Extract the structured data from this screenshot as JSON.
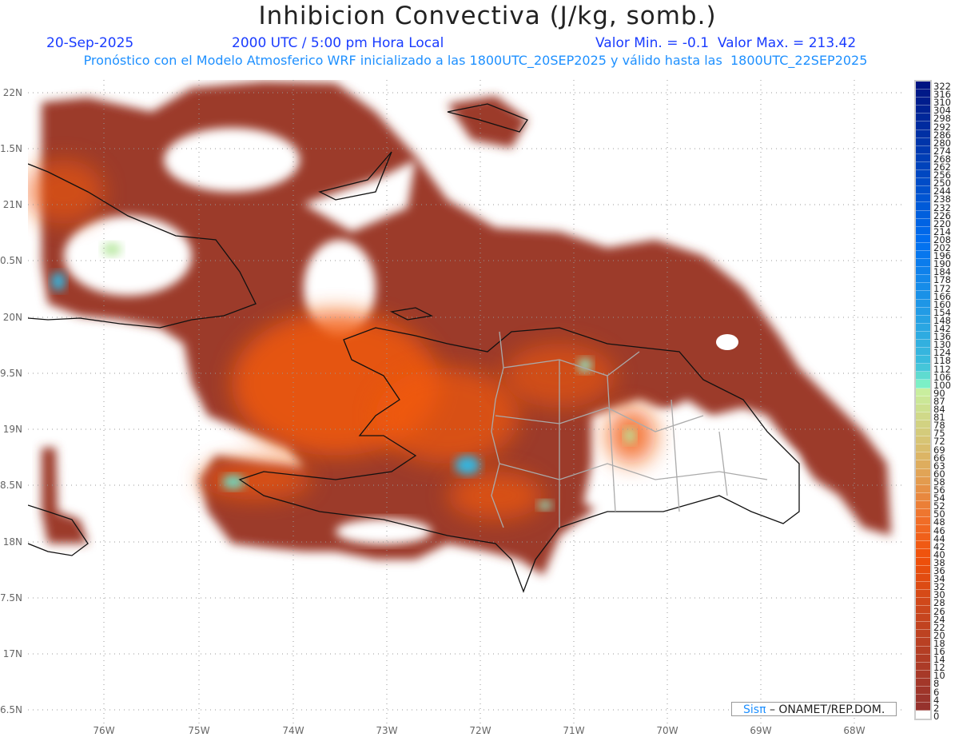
{
  "header": {
    "title": "Inhibicion Convectiva (J/kg, somb.)",
    "date": "20-Sep-2025",
    "time": "2000 UTC / 5:00 pm Hora Local",
    "minmax": "Valor Min. = -0.1  Valor Max. = 213.42",
    "subtitle": "Pronóstico con el Modelo Atmosferico WRF inicializado a las 1800UTC_20SEP2025 y válido hasta las  1800UTC_22SEP2025"
  },
  "axes": {
    "lon_labels": [
      "76W",
      "75W",
      "74W",
      "73W",
      "72W",
      "71W",
      "70W",
      "69W",
      "68W"
    ],
    "lat_labels": [
      "22N",
      "1.5N",
      "21N",
      "0.5N",
      "20N",
      "9.5N",
      "19N",
      "8.5N",
      "18N",
      "7.5N",
      "17N",
      "6.5N"
    ]
  },
  "colorbar": {
    "levels": [
      "322",
      "316",
      "310",
      "304",
      "298",
      "292",
      "286",
      "280",
      "274",
      "268",
      "262",
      "256",
      "250",
      "244",
      "238",
      "232",
      "226",
      "220",
      "214",
      "208",
      "202",
      "196",
      "190",
      "184",
      "178",
      "172",
      "166",
      "160",
      "154",
      "148",
      "142",
      "136",
      "130",
      "124",
      "118",
      "112",
      "106",
      "100",
      "90",
      "87",
      "84",
      "81",
      "78",
      "75",
      "72",
      "69",
      "66",
      "63",
      "60",
      "58",
      "56",
      "54",
      "52",
      "50",
      "48",
      "46",
      "44",
      "42",
      "40",
      "38",
      "36",
      "34",
      "32",
      "30",
      "28",
      "26",
      "24",
      "22",
      "20",
      "18",
      "16",
      "14",
      "12",
      "10",
      "8",
      "6",
      "4",
      "2",
      "0"
    ]
  },
  "credit": {
    "sis": "Sisπ",
    "org": " – ONAMET/REP.DOM."
  },
  "colors": {
    "field_low": "#9c3a2a",
    "field_mid": "#f25a10",
    "field_high": "#35b6e0"
  }
}
